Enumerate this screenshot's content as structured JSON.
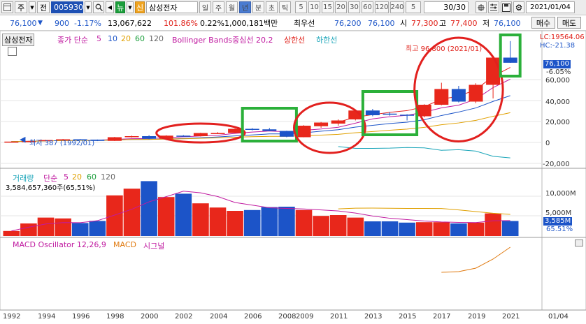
{
  "toolbar": {
    "btn_ju": "주",
    "btn_jeon": "전",
    "stock_code": "005930",
    "btn_new": "뉴",
    "btn_sin": "신",
    "stock_name": "삼성전자",
    "periods": [
      "일",
      "주",
      "월",
      "년",
      "분",
      "초",
      "틱"
    ],
    "selected_period": "년",
    "numbers": [
      "5",
      "10",
      "15",
      "20",
      "30",
      "60",
      "120",
      "240",
      "5"
    ],
    "count_value": "30/30",
    "date_value": "2021/01/04"
  },
  "quote": {
    "price": "76,100",
    "change": "900",
    "change_pct": "-1.17%",
    "volume": "13,067,622",
    "vol_ratio": "101.86%",
    "turnover_pct": "0.22%",
    "amount": "1,000,181백만",
    "best_ask_label": "최우선",
    "best_ask": "76,200",
    "best_bid": "76,100",
    "open_label": "시",
    "open": "77,300",
    "high_label": "고",
    "high": "77,400",
    "low_label": "저",
    "low": "76,100",
    "buy_label": "매수",
    "sell_label": "매도"
  },
  "price_panel": {
    "title": "삼성전자",
    "legend_close": "종가 단순",
    "ma": [
      "5",
      "10",
      "20",
      "60",
      "120"
    ],
    "bollinger": "Bollinger Bands중심선 20,2",
    "upper": "상한선",
    "lower": "하한선",
    "lc": "LC:19564.06",
    "hc": "HC:-21.38",
    "annot_high": "최고 96,800 (2021/01)",
    "annot_low": "최저 387 (1992/01)",
    "last_price": "76,100",
    "last_pct": "-6.05%",
    "ticks": [
      "60,000",
      "40,000",
      "20,000",
      "0",
      "-20,000"
    ]
  },
  "volume_panel": {
    "legend_volume": "거래량",
    "legend_simple": "단순",
    "ma": [
      "5",
      "20",
      "60",
      "120"
    ],
    "info": "3,584,657,360주(65,51%)",
    "ticks": [
      "10,000M",
      "5,000M"
    ],
    "last_vol": "3,585M",
    "last_pct": "65.51%"
  },
  "macd_panel": {
    "legend_osc": "MACD Oscillator 12,26,9",
    "legend_macd": "MACD",
    "legend_signal": "시그널"
  },
  "x_axis": [
    "1992",
    "1994",
    "1996",
    "1998",
    "2000",
    "2002",
    "2004",
    "2006",
    "2008",
    "2009",
    "2011",
    "2013",
    "2015",
    "2017",
    "2019",
    "2021",
    "01/04"
  ],
  "colors": {
    "up": "#e8271b",
    "down": "#1c54c8",
    "highlight_green": "#2bb03a",
    "highlight_red": "#e2201e"
  },
  "chart_data": [
    {
      "type": "candlestick",
      "title": "삼성전자",
      "x": [
        "1992",
        "1993",
        "1994",
        "1995",
        "1996",
        "1997",
        "1998",
        "1999",
        "2000",
        "2001",
        "2002",
        "2003",
        "2004",
        "2005",
        "2006",
        "2007",
        "2008",
        "2009",
        "2010",
        "2011",
        "2012",
        "2013",
        "2014",
        "2015",
        "2016",
        "2017",
        "2018",
        "2019",
        "2020",
        "2021"
      ],
      "open": [
        400,
        800,
        1300,
        2300,
        3000,
        2700,
        1500,
        5000,
        6000,
        3500,
        6500,
        6000,
        9000,
        9000,
        13000,
        12500,
        11000,
        5000,
        15500,
        18000,
        22000,
        30500,
        27500,
        26500,
        25000,
        36000,
        51000,
        39000,
        55000,
        81000
      ],
      "close": [
        800,
        1300,
        2300,
        3000,
        2600,
        1500,
        5000,
        6000,
        3500,
        6500,
        6000,
        9000,
        9000,
        13000,
        12500,
        11000,
        5500,
        16000,
        19000,
        21000,
        30500,
        26000,
        26500,
        25500,
        36000,
        51000,
        39000,
        55000,
        81000,
        76100
      ],
      "high": [
        900,
        1400,
        2500,
        3300,
        3200,
        2800,
        5300,
        6500,
        6900,
        6900,
        7000,
        9300,
        9800,
        13500,
        13700,
        13800,
        11200,
        16500,
        19500,
        22000,
        31500,
        32000,
        29000,
        27000,
        36500,
        57000,
        54000,
        56500,
        81600,
        96800
      ],
      "low": [
        387,
        700,
        1200,
        2100,
        2500,
        1300,
        1400,
        4700,
        3000,
        3300,
        5500,
        5700,
        8500,
        8700,
        11500,
        10800,
        5000,
        4900,
        14000,
        16000,
        21000,
        25000,
        25500,
        21000,
        24000,
        35500,
        38200,
        37500,
        42000,
        76000
      ],
      "ylim": [
        -25000,
        100000
      ]
    },
    {
      "type": "bar",
      "title": "거래량",
      "x": [
        "1992",
        "1993",
        "1994",
        "1995",
        "1996",
        "1997",
        "1998",
        "1999",
        "2000",
        "2001",
        "2002",
        "2003",
        "2004",
        "2005",
        "2006",
        "2007",
        "2008",
        "2009",
        "2010",
        "2011",
        "2012",
        "2013",
        "2014",
        "2015",
        "2016",
        "2017",
        "2018",
        "2019",
        "2020",
        "2021"
      ],
      "values": [
        1200,
        3000,
        4400,
        4200,
        3100,
        3600,
        9700,
        11300,
        13100,
        9300,
        10100,
        7800,
        6800,
        6000,
        6200,
        6900,
        7000,
        6200,
        4800,
        5000,
        4400,
        3500,
        3500,
        3200,
        3300,
        3300,
        3000,
        3200,
        5400,
        3585
      ],
      "units": "M"
    }
  ]
}
